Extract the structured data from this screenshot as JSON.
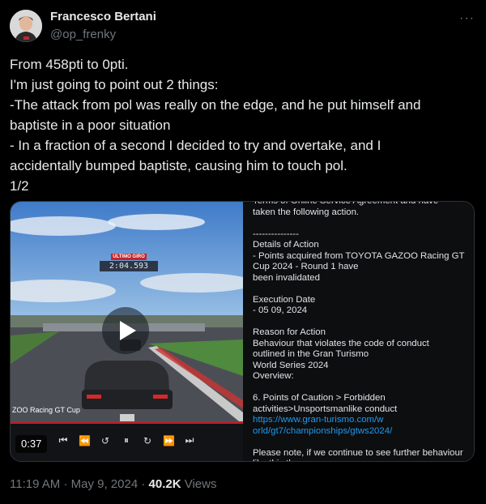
{
  "author": {
    "name": "Francesco Bertani",
    "handle": "@op_frenky"
  },
  "more_label": "···",
  "tweet_lines": [
    "From 458pti to 0pti.",
    "I'm just going to point out 2 things:",
    "-The attack from pol was really on the edge, and he put himself and",
    "baptiste in a poor situation",
    "- In a fraction of a second I decided to try and overtake, and I",
    "accidentally bumped baptiste, causing him to touch pol.",
    "1/2"
  ],
  "video": {
    "lap_label": "ULTIMO GIRO",
    "lap_time": "2:04.593",
    "cup_label": "ZOO Racing GT Cup",
    "duration": "0:37"
  },
  "doc_lines": [
    {
      "text": "Terms of Online Service Agreement and have",
      "link": false
    },
    {
      "text": "taken the following action.",
      "link": false
    },
    {
      "text": "",
      "link": false
    },
    {
      "text": "---------------",
      "link": false
    },
    {
      "text": "Details of Action",
      "link": false
    },
    {
      "text": "- Points acquired from TOYOTA GAZOO Racing GT",
      "link": false
    },
    {
      "text": "Cup 2024 - Round 1 have",
      "link": false
    },
    {
      "text": "been invalidated",
      "link": false
    },
    {
      "text": "",
      "link": false
    },
    {
      "text": "Execution Date",
      "link": false
    },
    {
      "text": "- 05 09, 2024",
      "link": false
    },
    {
      "text": "",
      "link": false
    },
    {
      "text": "Reason for Action",
      "link": false
    },
    {
      "text": "Behaviour that violates the code of conduct",
      "link": false
    },
    {
      "text": "outlined in the Gran Turismo",
      "link": false
    },
    {
      "text": "World Series 2024",
      "link": false
    },
    {
      "text": "Overview:",
      "link": false
    },
    {
      "text": "",
      "link": false
    },
    {
      "text": "6. Points of Caution > Forbidden",
      "link": false
    },
    {
      "text": "activities>Unsportsmanlike conduct",
      "link": false
    },
    {
      "text": "https://www.gran-turismo.com/w",
      "link": true
    },
    {
      "text": "orld/gt7/championships/gtws2024/",
      "link": true
    },
    {
      "text": "",
      "link": false
    },
    {
      "text": "Please note, if we continue to see further behaviour",
      "link": false
    },
    {
      "text": "like this then we",
      "link": false
    }
  ],
  "meta": {
    "time": "11:19 AM",
    "date": "May 9, 2024",
    "views_count": "40.2K",
    "views_label": "Views",
    "separator": "·"
  }
}
